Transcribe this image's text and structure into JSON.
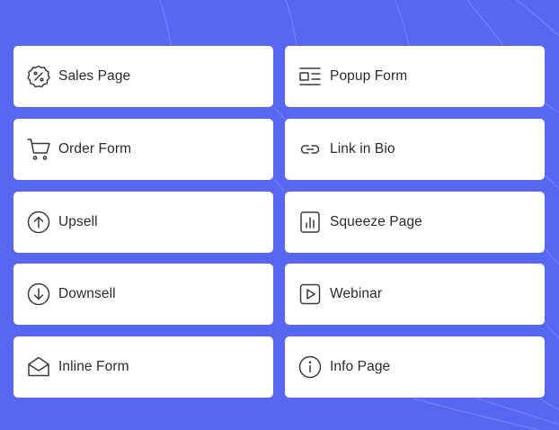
{
  "colors": {
    "background": "#5767f2",
    "card": "#ffffff",
    "text": "#2b2b2b",
    "icon": "#3a3a3a"
  },
  "cards": [
    {
      "label": "Sales Page",
      "icon": "discount-badge-icon"
    },
    {
      "label": "Popup Form",
      "icon": "popup-layout-icon"
    },
    {
      "label": "Order Form",
      "icon": "shopping-cart-icon"
    },
    {
      "label": "Link in Bio",
      "icon": "link-icon"
    },
    {
      "label": "Upsell",
      "icon": "arrow-up-circle-icon"
    },
    {
      "label": "Squeeze Page",
      "icon": "bar-chart-icon"
    },
    {
      "label": "Downsell",
      "icon": "arrow-down-circle-icon"
    },
    {
      "label": "Webinar",
      "icon": "play-square-icon"
    },
    {
      "label": "Inline Form",
      "icon": "mail-open-icon"
    },
    {
      "label": "Info Page",
      "icon": "info-circle-icon"
    }
  ]
}
